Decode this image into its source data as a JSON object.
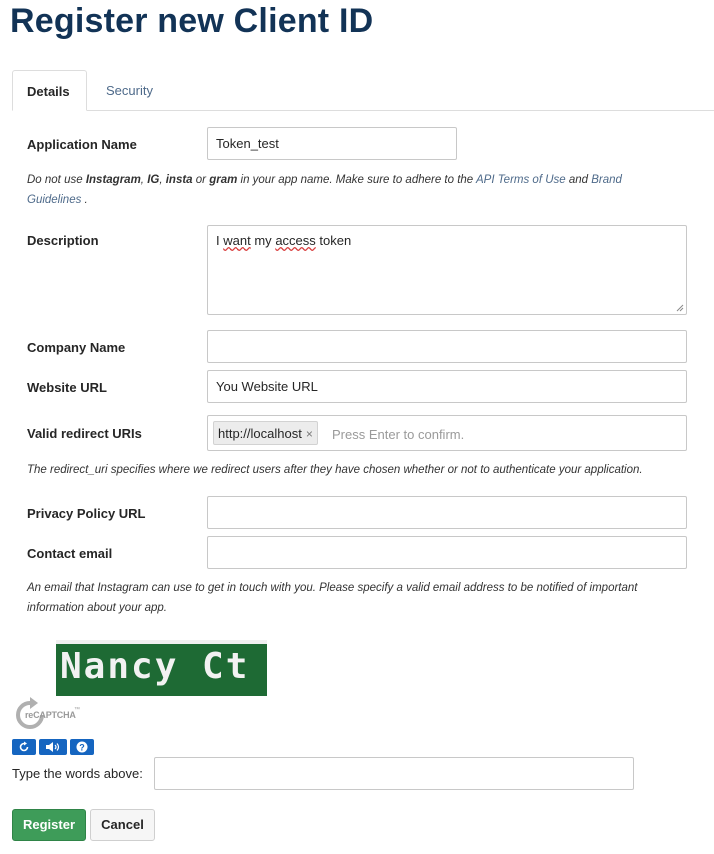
{
  "page": {
    "title": "Register new Client ID"
  },
  "tabs": [
    {
      "label": "Details",
      "active": true
    },
    {
      "label": "Security",
      "active": false
    }
  ],
  "form": {
    "application_name": {
      "label": "Application Name",
      "value": "Token_test"
    },
    "app_name_help": {
      "t1": "Do not use ",
      "b1": "Instagram",
      "t2": ", ",
      "b2": "IG",
      "t3": ", ",
      "b3": "insta",
      "t4": " or ",
      "b4": "gram",
      "t5": " in your app name. Make sure to adhere to the ",
      "link1": "API Terms of Use",
      "t6": " and ",
      "link2a": "Brand",
      "link2b": "Guidelines",
      "t7": " ."
    },
    "description": {
      "label": "Description",
      "value_word1": "I",
      "value_word2": "want",
      "value_word3": "my",
      "value_word4": "access",
      "value_word5": "token"
    },
    "company_name": {
      "label": "Company Name",
      "value": ""
    },
    "website_url": {
      "label": "Website URL",
      "value": "You Website URL"
    },
    "redirect_uris": {
      "label": "Valid redirect URIs",
      "token": "http://localhost",
      "remove": "×",
      "placeholder": "Press Enter to confirm.",
      "help": "The redirect_uri specifies where we redirect users after they have chosen whether or not to authenticate your application."
    },
    "privacy_policy_url": {
      "label": "Privacy Policy URL",
      "value": ""
    },
    "contact_email": {
      "label": "Contact email",
      "value": "",
      "help_line1": "An email that Instagram can use to get in touch with you. Please specify a valid email address to be notified of important",
      "help_line2": "information about your app."
    }
  },
  "captcha": {
    "image_text": "Nancy Ct",
    "logo_text": "reCAPTCHA",
    "tm": "™",
    "type_label": "Type the words above:",
    "colors": {
      "accent": "#1565c0"
    }
  },
  "actions": {
    "register": "Register",
    "cancel": "Cancel"
  },
  "colors": {
    "title": "#123356",
    "register": "#3e9c59",
    "link": "#4e6a8a"
  }
}
